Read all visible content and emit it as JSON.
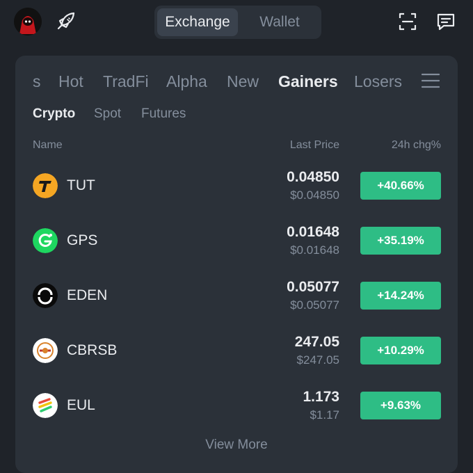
{
  "header": {
    "toggle": {
      "exchange_label": "Exchange",
      "wallet_label": "Wallet",
      "selected": "Exchange"
    }
  },
  "market": {
    "tabs": [
      {
        "label": "s"
      },
      {
        "label": "Hot"
      },
      {
        "label": "TradFi"
      },
      {
        "label": "Alpha"
      },
      {
        "label": "New"
      },
      {
        "label": "Gainers",
        "active": true
      },
      {
        "label": "Losers"
      }
    ],
    "subtabs": [
      {
        "label": "Crypto",
        "active": true
      },
      {
        "label": "Spot"
      },
      {
        "label": "Futures"
      }
    ],
    "columns": {
      "name": "Name",
      "last_price": "Last Price",
      "change": "24h chg%"
    },
    "rows": [
      {
        "symbol": "TUT",
        "price": "0.04850",
        "usd": "$0.04850",
        "change": "+40.66%",
        "icon": "tut-icon"
      },
      {
        "symbol": "GPS",
        "price": "0.01648",
        "usd": "$0.01648",
        "change": "+35.19%",
        "icon": "gps-icon"
      },
      {
        "symbol": "EDEN",
        "price": "0.05077",
        "usd": "$0.05077",
        "change": "+14.24%",
        "icon": "eden-icon"
      },
      {
        "symbol": "CBRSB",
        "price": "247.05",
        "usd": "$247.05",
        "change": "+10.29%",
        "icon": "cbrsb-icon"
      },
      {
        "symbol": "EUL",
        "price": "1.173",
        "usd": "$1.17",
        "change": "+9.63%",
        "icon": "eul-icon"
      }
    ],
    "view_more": "View More"
  },
  "colors": {
    "background": "#1f2329",
    "card": "#2b3139",
    "positive": "#2ebd85",
    "text_primary": "#eaecef",
    "text_secondary": "#848e9c"
  }
}
